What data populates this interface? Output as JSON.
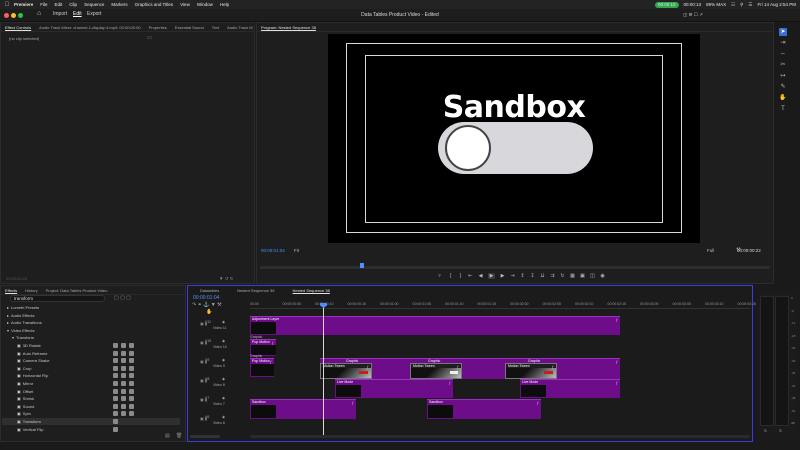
{
  "menubar": {
    "app": "Premiere",
    "items": [
      "File",
      "Edit",
      "Clip",
      "Sequence",
      "Markers",
      "Graphics and Titles",
      "View",
      "Window",
      "Help"
    ],
    "recording_time": "00:00:10",
    "time_counter": "00:00:13",
    "battery": "89% MAX",
    "datetime": "Fri 14 Aug  2:54 PM"
  },
  "app_header": {
    "tabs": [
      "Import",
      "Edit",
      "Export"
    ],
    "active_tab": "Edit",
    "doc_title": "Data Tables Product Video - Edited"
  },
  "source_panel": {
    "tabs": [
      "Effect Controls",
      "Audio Track Mixer: channel-1-display-4.mp4: 00:00:00:00",
      "Properties",
      "Essential Sound",
      "Text",
      "Audio Track M"
    ],
    "no_clip": "(no clip selected)",
    "bottom_timecode": "00:00:01:04"
  },
  "program_monitor": {
    "tab": "Program: Nested Sequence 38",
    "title_text": "Sandbox",
    "timecode": "00:00:01:04",
    "fit": "Fit",
    "resolution": "Full",
    "duration": "00:00:00:22"
  },
  "effects_panel": {
    "tabs": [
      "Effects",
      "History",
      "Project: Data Tables Product Video"
    ],
    "search_value": "transform",
    "items": [
      {
        "label": "Lumetri Presets",
        "indent": 1,
        "badges": 0
      },
      {
        "label": "Audio Effects",
        "indent": 1,
        "badges": 0
      },
      {
        "label": "Audio Transitions",
        "indent": 1,
        "badges": 0
      },
      {
        "label": "Video Effects",
        "indent": 1,
        "badges": 0
      },
      {
        "label": "Transform",
        "indent": 2,
        "badges": 0
      },
      {
        "label": "3D Rotate",
        "indent": 3,
        "badges": 3
      },
      {
        "label": "Auto Reframe",
        "indent": 3,
        "badges": 3
      },
      {
        "label": "Camera Shake",
        "indent": 3,
        "badges": 3
      },
      {
        "label": "Crop",
        "indent": 3,
        "badges": 3
      },
      {
        "label": "Horizontal Flip",
        "indent": 3,
        "badges": 3
      },
      {
        "label": "Mirror",
        "indent": 3,
        "badges": 3
      },
      {
        "label": "Offset",
        "indent": 3,
        "badges": 3
      },
      {
        "label": "Shrink",
        "indent": 3,
        "badges": 3
      },
      {
        "label": "Sound",
        "indent": 3,
        "badges": 3
      },
      {
        "label": "Spin",
        "indent": 3,
        "badges": 3
      },
      {
        "label": "Transform",
        "indent": 3,
        "badges": 1,
        "selected": true
      },
      {
        "label": "Vertical Flip",
        "indent": 3,
        "badges": 1
      }
    ]
  },
  "timeline": {
    "tabs": [
      "Datatables",
      "Nested Sequence 36",
      "Nested Sequence 38"
    ],
    "timecode": "00:00:01:04",
    "ruler": [
      "00:00",
      "00:00:00:05",
      "00:00:00:10",
      "00:00:00:15",
      "00:00:01:00",
      "00:00:01:05",
      "00:00:01:10",
      "00:00:01:15",
      "00:00:02:00",
      "00:00:02:05",
      "00:00:02:10",
      "00:00:02:15",
      "00:00:03:00",
      "00:00:03:05",
      "00:00:03:10",
      "00:00:03:15"
    ],
    "tracks": [
      {
        "id": "V11",
        "label": "Video 11"
      },
      {
        "id": "V10",
        "label": "Video 10"
      },
      {
        "id": "V9",
        "label": "Video 9"
      },
      {
        "id": "V8",
        "label": "Video 8"
      },
      {
        "id": "V7",
        "label": "Video 7"
      },
      {
        "id": "V6",
        "label": "Video 6"
      }
    ],
    "clips": {
      "adjustment": "Adjustment Layer",
      "pop_motion_1": "Pop Motion",
      "graphic_1": "Graphic",
      "pop_motion_2": "Pop Motion",
      "graphic_2": "Graphic",
      "motion_tween_1": "Motion Tween",
      "graphic_3": "Graphic",
      "motion_tween_2": "Motion Tween",
      "graphic_4": "Graphic",
      "motion_tween_3": "Motion Tween",
      "graphic_5": "Graphic",
      "live_mode_1": "Live Mode",
      "live_mode_2": "Live Mode",
      "sandbox_1": "Sandbox",
      "sandbox_2": "Sandbox"
    }
  },
  "meters": {
    "ticks": [
      "0",
      "-6",
      "-12",
      "-18",
      "-24",
      "-30",
      "-36",
      "-42",
      "-48",
      "-54",
      "dB"
    ],
    "labels": [
      "S",
      "S"
    ]
  }
}
